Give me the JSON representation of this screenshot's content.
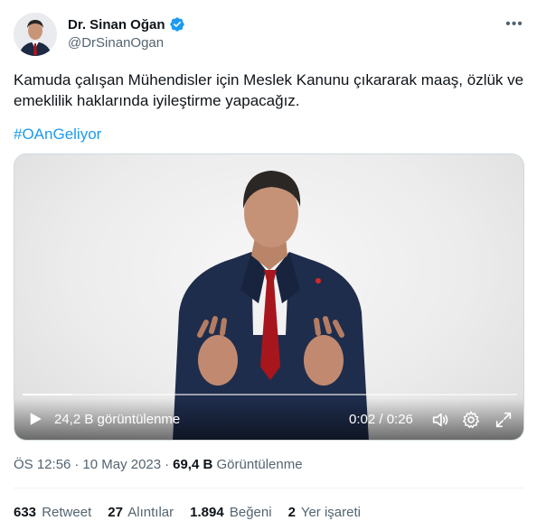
{
  "author": {
    "name": "Dr. Sinan Oğan",
    "handle": "@DrSinanOgan",
    "verified_icon": "verified-badge-icon"
  },
  "tweet": {
    "text": "Kamuda çalışan Mühendisler için Meslek Kanunu çıkararak maaş, özlük ve emeklilik haklarında iyileştirme yapacağız.",
    "hashtag": "#OAnGeliyor"
  },
  "video": {
    "views": "24,2 B görüntülenme",
    "time": "0:02 / 0:26",
    "progress": 0.1
  },
  "meta": {
    "time": "ÖS 12:56",
    "separator1": "·",
    "date": "10 May 2023",
    "separator2": "·",
    "views_count": "69,4 B",
    "views_label": "Görüntülenme"
  },
  "stats": {
    "retweets_count": "633",
    "retweets_label": "Retweet",
    "quotes_count": "27",
    "quotes_label": "Alıntılar",
    "likes_count": "1.894",
    "likes_label": "Beğeni",
    "bookmarks_count": "2",
    "bookmarks_label": "Yer işareti"
  },
  "colors": {
    "accent": "#1d9bf0",
    "text": "#0f1419",
    "secondary": "#536471"
  }
}
